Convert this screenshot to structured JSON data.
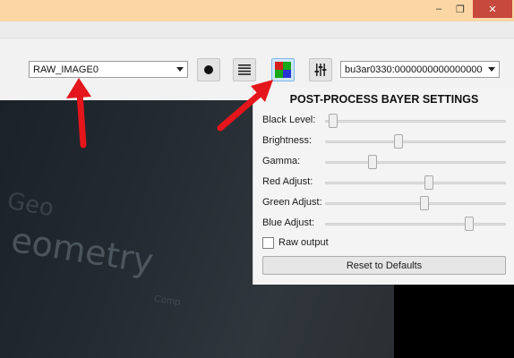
{
  "window": {
    "minimize_symbol": "–",
    "maximize_symbol": "❐",
    "close_symbol": "✕"
  },
  "toolbar": {
    "source_combo": {
      "value": "RAW_IMAGE0"
    },
    "record_icon": "record-icon",
    "menu_icon": "list-icon",
    "bayer_icon": "bayer-grid-icon",
    "settings_icon": "sliders-icon",
    "device_combo": {
      "value": "bu3ar0330:0000000000000000"
    }
  },
  "colors": {
    "bayer_red": "#d62020",
    "bayer_green": "#16a816",
    "bayer_blue": "#2a33d6",
    "annotation_red": "#e4161b",
    "close_button": "#c7483d"
  },
  "image": {
    "text_line_1": "eometry",
    "text_line_2": "Geo",
    "text_line_3": "Comp"
  },
  "panel": {
    "title": "POST-PROCESS BAYER SETTINGS",
    "sliders": [
      {
        "label": "Black Level:",
        "value": 0.02
      },
      {
        "label": "Brightness:",
        "value": 0.4
      },
      {
        "label": "Gamma:",
        "value": 0.25
      },
      {
        "label": "Red Adjust:",
        "value": 0.58
      },
      {
        "label": "Green Adjust:",
        "value": 0.55
      },
      {
        "label": "Blue Adjust:",
        "value": 0.81
      }
    ],
    "raw_output": {
      "label": "Raw output",
      "checked": false
    },
    "reset_label": "Reset to Defaults"
  }
}
